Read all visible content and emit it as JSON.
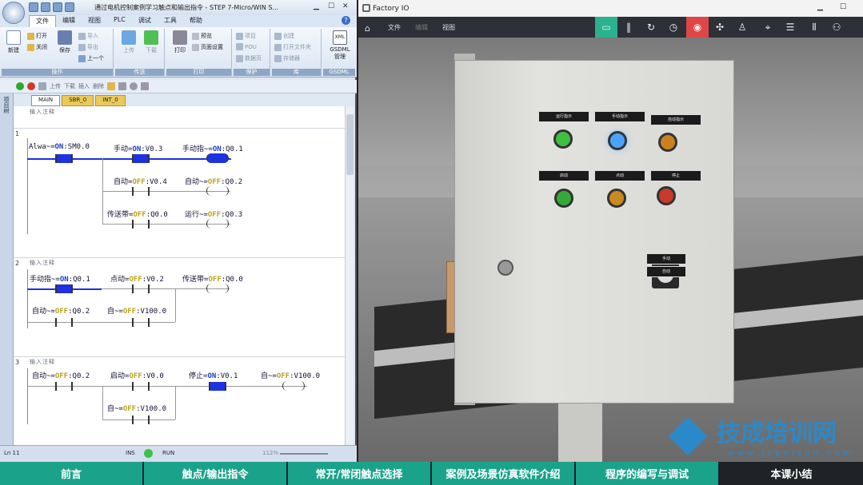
{
  "left_window": {
    "title": "通过电机控制案例学习触点和输出指令 - STEP 7-Micro/WIN S...",
    "ribbon_tabs": [
      "文件",
      "编辑",
      "视图",
      "PLC",
      "调试",
      "工具",
      "帮助"
    ],
    "groups": {
      "operations": {
        "label": "操作",
        "new": "新建",
        "open": "打开",
        "close": "关闭",
        "save": "保存",
        "import": "导入",
        "export": "导出",
        "prev": "上一个"
      },
      "transfer": {
        "label": "传送",
        "upload": "上传",
        "download": "下载"
      },
      "print": {
        "label": "打印",
        "print": "打印",
        "preview": "预览",
        "page_setup": "页面设置"
      },
      "protect": {
        "label": "保护",
        "project": "项目",
        "pou": "POU",
        "data_page": "数据页"
      },
      "library": {
        "label": "库",
        "create": "创建",
        "open_folder": "打开文件夹",
        "memory": "存储器"
      },
      "gsdml": {
        "label": "GSDML",
        "manage": "GSDML 管理",
        "xml": "XML"
      }
    },
    "toolbar": {
      "upload": "上传",
      "download": "下载",
      "insert": "插入",
      "delete": "删除"
    },
    "side_label": "项目树",
    "program_tabs": [
      "MAIN",
      "SBR_0",
      "INT_0"
    ],
    "networks": [
      {
        "num": "1",
        "comment": "输入注释"
      },
      {
        "num": "2",
        "comment": "输入注释"
      },
      {
        "num": "3",
        "comment": "输入注释"
      }
    ],
    "ladder": {
      "n1": [
        {
          "name": "Alwa~",
          "state": "ON",
          "addr": "SM0.0"
        },
        {
          "name": "手动",
          "state": "ON",
          "addr": "V0.3"
        },
        {
          "name": "手动指~",
          "state": "ON",
          "addr": "Q0.1"
        },
        {
          "name": "自动",
          "state": "OFF",
          "addr": "V0.4"
        },
        {
          "name": "自动~",
          "state": "OFF",
          "addr": "Q0.2"
        },
        {
          "name": "传送带",
          "state": "OFF",
          "addr": "Q0.0"
        },
        {
          "name": "运行~",
          "state": "OFF",
          "addr": "Q0.3"
        }
      ],
      "n2": [
        {
          "name": "手动指~",
          "state": "ON",
          "addr": "Q0.1"
        },
        {
          "name": "点动",
          "state": "OFF",
          "addr": "V0.2"
        },
        {
          "name": "传送带",
          "state": "OFF",
          "addr": "Q0.0"
        },
        {
          "name": "自动~",
          "state": "OFF",
          "addr": "Q0.2"
        },
        {
          "name": "自~",
          "state": "OFF",
          "addr": "V100.0"
        }
      ],
      "n3": [
        {
          "name": "自动~",
          "state": "OFF",
          "addr": "Q0.2"
        },
        {
          "name": "启动",
          "state": "OFF",
          "addr": "V0.0"
        },
        {
          "name": "停止",
          "state": "ON",
          "addr": "V0.1"
        },
        {
          "name": "自~",
          "state": "OFF",
          "addr": "V100.0"
        },
        {
          "name": "自~",
          "state": "OFF",
          "addr": "V100.0"
        }
      ]
    },
    "status": {
      "line": "Ln 11",
      "ins": "INS",
      "run": "RUN",
      "zoom": "112%"
    }
  },
  "right_window": {
    "title": "Factory IO",
    "menu": [
      "文件",
      "编辑",
      "视图"
    ],
    "panel_labels": [
      "运行指示",
      "手动指示",
      "自动指示",
      "启动",
      "点动",
      "停止",
      "手动",
      "自动"
    ],
    "lamp_colors": [
      "#3fbf3f",
      "#4aa3ff",
      "#c9811f",
      "#35a83a",
      "#c98a1f",
      "#c83a2a"
    ]
  },
  "watermark": {
    "text": "技成培训网",
    "url": "www.jcpeixun.com"
  },
  "bottom_nav": [
    "前言",
    "触点/输出指令",
    "常开/常闭触点选择",
    "案例及场景仿真软件介绍",
    "程序的编写与调试",
    "本课小结"
  ]
}
